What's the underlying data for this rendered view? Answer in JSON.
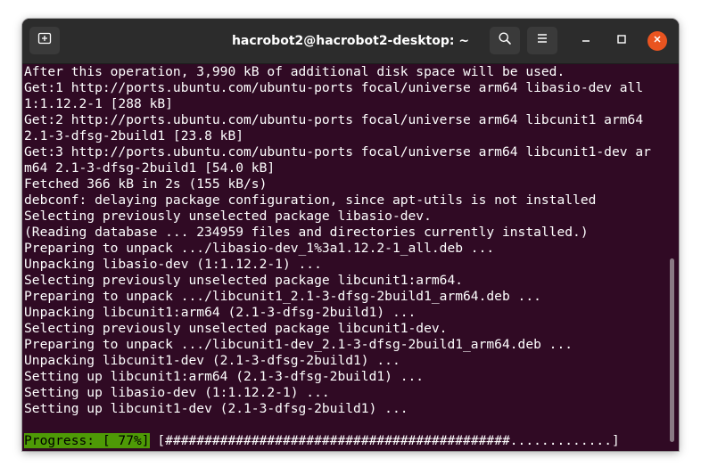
{
  "window": {
    "title": "hacrobot2@hacrobot2-desktop: ~"
  },
  "icons": {
    "new_tab": "new-tab-icon",
    "search": "search-icon",
    "menu": "hamburger-menu-icon",
    "minimize": "minimize-icon",
    "maximize": "maximize-icon",
    "close": "close-icon"
  },
  "colors": {
    "terminal_bg": "#300a24",
    "titlebar_bg": "#2c2c2c",
    "close_button": "#e95420",
    "progress_highlight": "#4e9a06"
  },
  "terminal": {
    "lines": [
      "After this operation, 3,990 kB of additional disk space will be used.",
      "Get:1 http://ports.ubuntu.com/ubuntu-ports focal/universe arm64 libasio-dev all",
      "1:1.12.2-1 [288 kB]",
      "Get:2 http://ports.ubuntu.com/ubuntu-ports focal/universe arm64 libcunit1 arm64",
      "2.1-3-dfsg-2build1 [23.8 kB]",
      "Get:3 http://ports.ubuntu.com/ubuntu-ports focal/universe arm64 libcunit1-dev ar",
      "m64 2.1-3-dfsg-2build1 [54.0 kB]",
      "Fetched 366 kB in 2s (155 kB/s)",
      "debconf: delaying package configuration, since apt-utils is not installed",
      "Selecting previously unselected package libasio-dev.",
      "(Reading database ... 234959 files and directories currently installed.)",
      "Preparing to unpack .../libasio-dev_1%3a1.12.2-1_all.deb ...",
      "Unpacking libasio-dev (1:1.12.2-1) ...",
      "Selecting previously unselected package libcunit1:arm64.",
      "Preparing to unpack .../libcunit1_2.1-3-dfsg-2build1_arm64.deb ...",
      "Unpacking libcunit1:arm64 (2.1-3-dfsg-2build1) ...",
      "Selecting previously unselected package libcunit1-dev.",
      "Preparing to unpack .../libcunit1-dev_2.1-3-dfsg-2build1_arm64.deb ...",
      "Unpacking libcunit1-dev (2.1-3-dfsg-2build1) ...",
      "Setting up libcunit1:arm64 (2.1-3-dfsg-2build1) ...",
      "Setting up libasio-dev (1:1.12.2-1) ...",
      "Setting up libcunit1-dev (2.1-3-dfsg-2build1) ..."
    ],
    "progress": {
      "label": "Progress: [ 77%]",
      "bar": "[############################################.............]",
      "percent": 77
    }
  }
}
